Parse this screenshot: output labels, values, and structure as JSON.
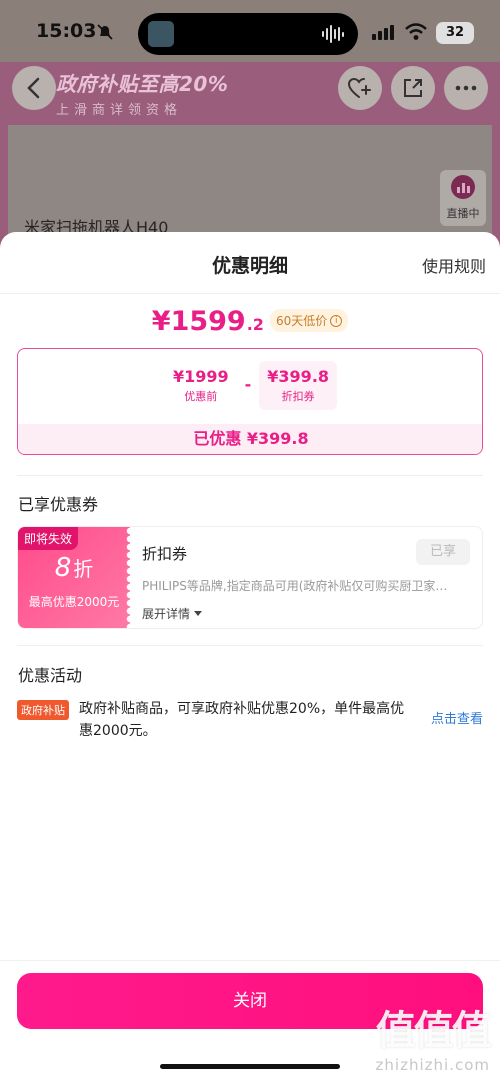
{
  "status_bar": {
    "time": "15:03",
    "battery": "32"
  },
  "background": {
    "promo_main": "政府补贴至高20%",
    "promo_sub": "上滑商详领资格",
    "product_title": "米家扫拖机器人H40",
    "live_label": "直播中"
  },
  "sheet": {
    "title": "优惠明细",
    "rules_link": "使用规则",
    "price": {
      "main": "¥1599",
      "decimal": ".2",
      "low_tag": "60天低价"
    },
    "calc": {
      "original_value": "¥1999",
      "original_label": "优惠前",
      "minus": "-",
      "discount_value": "¥399.8",
      "discount_label": "折扣券",
      "saved": "已优惠 ¥399.8"
    },
    "coupons_section_title": "已享优惠券",
    "coupon": {
      "expire_tag": "即将失效",
      "discount_number": "8",
      "discount_unit": "折",
      "max_text": "最高优惠2000元",
      "name": "折扣券",
      "used_label": "已享",
      "desc": "PHILIPS等品牌,指定商品可用(政府补贴仅可购买厨卫家…",
      "expand_label": "展开详情"
    },
    "activity_section_title": "优惠活动",
    "activity": {
      "tag": "政府补贴",
      "text": "政府补贴商品，可享政府补贴优惠20%，单件最高优惠2000元。",
      "link": "点击查看"
    },
    "close_button": "关闭"
  },
  "watermark": {
    "big": "值值值",
    "small": "zhizhizhi.com"
  },
  "colors": {
    "accent": "#e91e87",
    "button": "#ff1a8c",
    "link": "#2f7bd9",
    "gov_tag": "#f0592e"
  },
  "icons": [
    "back-arrow-icon",
    "heart-plus-icon",
    "share-icon",
    "more-icon",
    "info-icon",
    "chevron-down-icon",
    "live-icon"
  ]
}
